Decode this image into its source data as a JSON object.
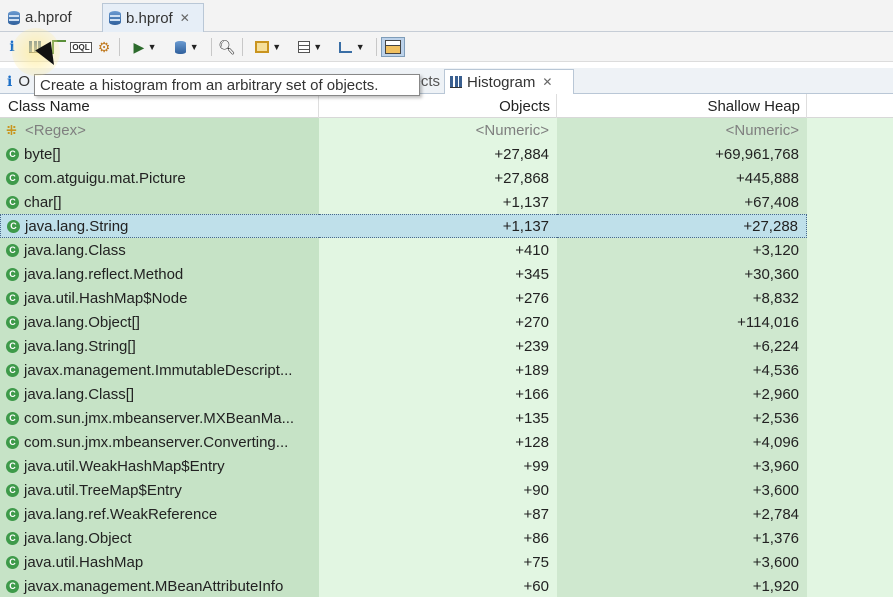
{
  "editor_tabs": [
    {
      "label": "a.hprof",
      "active": false
    },
    {
      "label": "b.hprof",
      "active": true
    }
  ],
  "toolbar": {
    "items": [
      "info-icon",
      "histogram-icon",
      "dominator-tree-icon",
      "oql-icon",
      "heap-dump-overview-icon",
      "run-report-icon",
      "query-browser-icon",
      "search-icon",
      "group-icon",
      "calculate-retained-icon",
      "export-icon",
      "layout-icon"
    ]
  },
  "tooltip": {
    "text": "Create a histogram from an arbitrary set of objects."
  },
  "view_tabs": {
    "overview_label": "O",
    "hidden_tab_label": "ects",
    "histogram_label": "Histogram"
  },
  "table": {
    "headers": {
      "class_name": "Class Name",
      "objects": "Objects",
      "shallow_heap": "Shallow Heap"
    },
    "filter_row": {
      "class_name": "<Regex>",
      "objects": "<Numeric>",
      "shallow_heap": "<Numeric>"
    },
    "rows": [
      {
        "class_name": "byte[]",
        "objects": "+27,884",
        "shallow_heap": "+69,961,768"
      },
      {
        "class_name": "com.atguigu.mat.Picture",
        "objects": "+27,868",
        "shallow_heap": "+445,888"
      },
      {
        "class_name": "char[]",
        "objects": "+1,137",
        "shallow_heap": "+67,408"
      },
      {
        "class_name": "java.lang.String",
        "objects": "+1,137",
        "shallow_heap": "+27,288"
      },
      {
        "class_name": "java.lang.Class",
        "objects": "+410",
        "shallow_heap": "+3,120"
      },
      {
        "class_name": "java.lang.reflect.Method",
        "objects": "+345",
        "shallow_heap": "+30,360"
      },
      {
        "class_name": "java.util.HashMap$Node",
        "objects": "+276",
        "shallow_heap": "+8,832"
      },
      {
        "class_name": "java.lang.Object[]",
        "objects": "+270",
        "shallow_heap": "+114,016"
      },
      {
        "class_name": "java.lang.String[]",
        "objects": "+239",
        "shallow_heap": "+6,224"
      },
      {
        "class_name": "javax.management.ImmutableDescript...",
        "objects": "+189",
        "shallow_heap": "+4,536"
      },
      {
        "class_name": "java.lang.Class[]",
        "objects": "+166",
        "shallow_heap": "+2,960"
      },
      {
        "class_name": "com.sun.jmx.mbeanserver.MXBeanMa...",
        "objects": "+135",
        "shallow_heap": "+2,536"
      },
      {
        "class_name": "com.sun.jmx.mbeanserver.Converting...",
        "objects": "+128",
        "shallow_heap": "+4,096"
      },
      {
        "class_name": "java.util.WeakHashMap$Entry",
        "objects": "+99",
        "shallow_heap": "+3,960"
      },
      {
        "class_name": "java.util.TreeMap$Entry",
        "objects": "+90",
        "shallow_heap": "+3,600"
      },
      {
        "class_name": "java.lang.ref.WeakReference",
        "objects": "+87",
        "shallow_heap": "+2,784"
      },
      {
        "class_name": "java.lang.Object",
        "objects": "+86",
        "shallow_heap": "+1,376"
      },
      {
        "class_name": "java.util.HashMap",
        "objects": "+75",
        "shallow_heap": "+3,600"
      },
      {
        "class_name": "javax.management.MBeanAttributeInfo",
        "objects": "+60",
        "shallow_heap": "+1,920"
      }
    ],
    "selected_row": 3
  },
  "colors": {
    "class_col_bg": "#c6e3c6",
    "objects_col_bg": "#e2f6e2",
    "heap_col_bg": "#cfe8cf",
    "selected_bg": "#bfe0ea",
    "class_icon": "#3e9a4a"
  }
}
